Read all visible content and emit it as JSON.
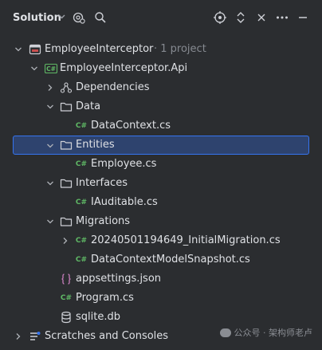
{
  "header": {
    "title": "Solution",
    "icons": [
      "chevron-down-icon",
      "settings-project-icon",
      "search-icon",
      "locate-icon",
      "expand-collapse-icon",
      "close-icon",
      "more-icon"
    ]
  },
  "tree": {
    "solution": {
      "label": "EmployeeInterceptor",
      "meta": "· 1 project"
    },
    "project": {
      "label": "EmployeeInterceptor.Api"
    },
    "dependencies": {
      "label": "Dependencies"
    },
    "data_folder": {
      "label": "Data"
    },
    "data_context": {
      "label": "DataContext.cs"
    },
    "entities_folder": {
      "label": "Entities"
    },
    "employee": {
      "label": "Employee.cs"
    },
    "interfaces_folder": {
      "label": "Interfaces"
    },
    "iauditable": {
      "label": "IAuditable.cs"
    },
    "migrations_folder": {
      "label": "Migrations"
    },
    "initial_migration": {
      "label": "20240501194649_InitialMigration.cs"
    },
    "snapshot": {
      "label": "DataContextModelSnapshot.cs"
    },
    "appsettings": {
      "label": "appsettings.json"
    },
    "program": {
      "label": "Program.cs"
    },
    "sqlite": {
      "label": "sqlite.db"
    },
    "scratches": {
      "label": "Scratches and Consoles"
    }
  },
  "watermark": {
    "text": "公众号 · 架构师老卢"
  },
  "colors": {
    "background": "#2b2d30",
    "selection": "#2e436e",
    "accent": "#3574f0",
    "csharp": "#5fb865"
  }
}
